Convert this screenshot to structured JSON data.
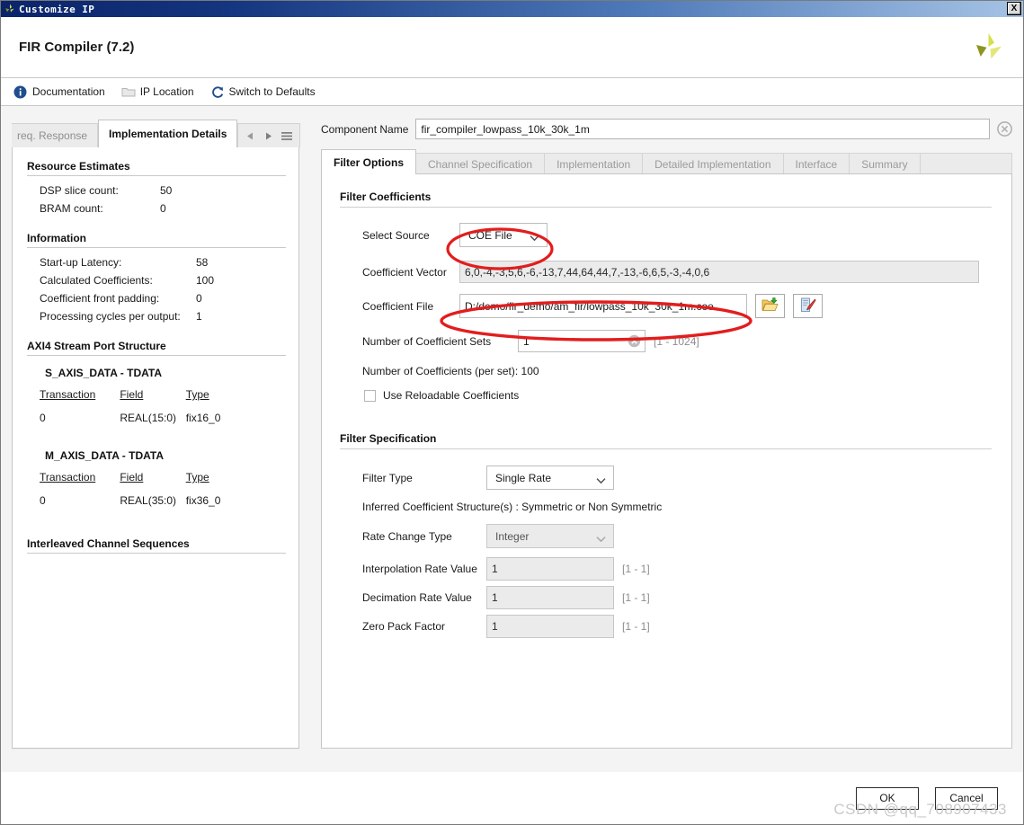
{
  "window": {
    "title": "Customize IP",
    "close_label": "X",
    "product_title": "FIR Compiler (7.2)",
    "brand_logo_icon": "xilinx-logo-icon"
  },
  "toolbar": {
    "items": [
      {
        "label": "Documentation",
        "icon": "info-icon"
      },
      {
        "label": "IP Location",
        "icon": "folder-icon"
      },
      {
        "label": "Switch to Defaults",
        "icon": "refresh-icon"
      }
    ]
  },
  "left_panel": {
    "tabs": [
      {
        "label": "req. Response",
        "active": false
      },
      {
        "label": "Implementation Details",
        "active": true
      }
    ],
    "nav": {
      "prev_icon": "triangle-left-icon",
      "next_icon": "triangle-right-icon",
      "menu_icon": "hamburger-menu-icon"
    },
    "sections": [
      {
        "title": "Resource Estimates",
        "rows": [
          {
            "key": "DSP slice count:",
            "value": "50"
          },
          {
            "key": "BRAM count:",
            "value": "0"
          }
        ]
      },
      {
        "title": "Information",
        "rows": [
          {
            "key": "Start-up Latency:",
            "value": "58"
          },
          {
            "key": "Calculated Coefficients:",
            "value": "100"
          },
          {
            "key": "Coefficient front padding:",
            "value": "0"
          },
          {
            "key": "Processing cycles per output:",
            "value": "1"
          }
        ]
      }
    ],
    "port_structure": {
      "title": "AXI4 Stream Port Structure",
      "groups": [
        {
          "name": "S_AXIS_DATA - TDATA",
          "headers": [
            "Transaction",
            "Field",
            "Type"
          ],
          "rows": [
            [
              "0",
              "REAL(15:0)",
              "fix16_0"
            ]
          ]
        },
        {
          "name": "M_AXIS_DATA - TDATA",
          "headers": [
            "Transaction",
            "Field",
            "Type"
          ],
          "rows": [
            [
              "0",
              "REAL(35:0)",
              "fix36_0"
            ]
          ]
        }
      ]
    },
    "interleaved_title": "Interleaved Channel Sequences"
  },
  "right_panel": {
    "component_name_label": "Component Name",
    "component_name_value": "fir_compiler_lowpass_10k_30k_1m",
    "clear_icon": "clear-circle-icon",
    "tabs": [
      {
        "label": "Filter Options",
        "active": true
      },
      {
        "label": "Channel Specification",
        "active": false
      },
      {
        "label": "Implementation",
        "active": false
      },
      {
        "label": "Detailed Implementation",
        "active": false
      },
      {
        "label": "Interface",
        "active": false
      },
      {
        "label": "Summary",
        "active": false
      }
    ],
    "filter_coefficients": {
      "group_title": "Filter Coefficients",
      "select_source_label": "Select Source",
      "select_source_value": "COE File",
      "coefficient_vector_label": "Coefficient Vector",
      "coefficient_vector_value": "6,0,-4,-3,5,6,-6,-13,7,44,64,44,7,-13,-6,6,5,-3,-4,0,6",
      "coefficient_file_label": "Coefficient File",
      "coefficient_file_value": "D:/demo/fir_demo/am_fir/lowpass_10k_30k_1m.coe",
      "browse_icon": "folder-open-icon",
      "edit_icon": "edit-file-icon",
      "num_sets_label": "Number of Coefficient Sets",
      "num_sets_value": "1",
      "num_sets_range": "[1 - 1024]",
      "num_coeffs_line": "Number of Coefficients (per set): 100",
      "reloadable_label": "Use Reloadable Coefficients",
      "reloadable_checked": false
    },
    "filter_specification": {
      "group_title": "Filter Specification",
      "filter_type_label": "Filter Type",
      "filter_type_value": "Single Rate",
      "inferred_line": "Inferred Coefficient Structure(s) : Symmetric or Non Symmetric",
      "rate_change_label": "Rate Change Type",
      "rate_change_value": "Integer",
      "interpolation_label": "Interpolation Rate Value",
      "interpolation_value": "1",
      "interpolation_range": "[1 - 1]",
      "decimation_label": "Decimation Rate Value",
      "decimation_value": "1",
      "decimation_range": "[1 - 1]",
      "zero_pack_label": "Zero Pack Factor",
      "zero_pack_value": "1",
      "zero_pack_range": "[1 - 1]"
    }
  },
  "footer": {
    "ok_label": "OK",
    "cancel_label": "Cancel"
  },
  "watermark": "CSDN @qq_708907433",
  "colors": {
    "titlebar_start": "#0a246a",
    "titlebar_end": "#a6c3e5",
    "annotation_red": "#e21d1d",
    "brand_olive": "#9aa01e",
    "brand_yellow": "#d9dd4a"
  }
}
